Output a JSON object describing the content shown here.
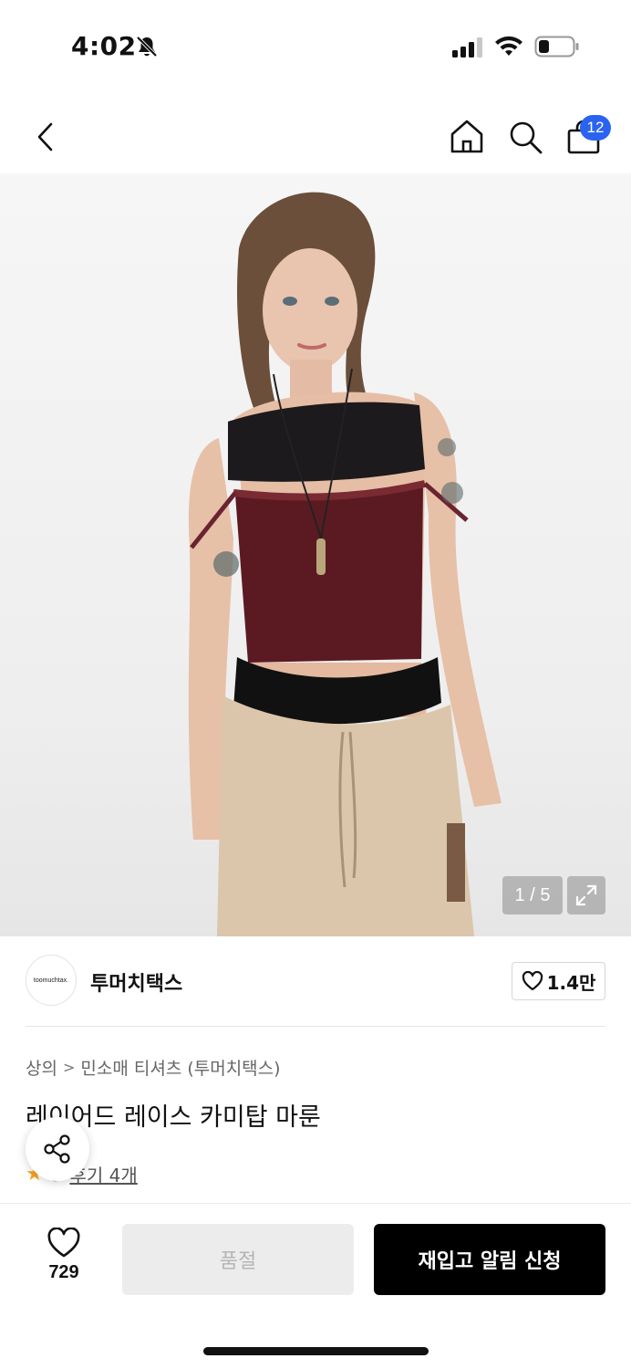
{
  "status": {
    "time": "4:02"
  },
  "header": {
    "cart_count": "12"
  },
  "gallery": {
    "counter": "1 / 5"
  },
  "brand": {
    "logo_text": "toomuchtax.",
    "name": "투머치택스",
    "likes": "1.4만"
  },
  "breadcrumb": {
    "category": "상의",
    "subcategory": "민소매 티셔츠 (투머치택스)"
  },
  "product": {
    "title": "레이어드 레이스 카미탑 마룬",
    "rating_partial": "5",
    "reviews": "후기 4개"
  },
  "bottom": {
    "wish_count": "729",
    "soldout_label": "품절",
    "restock_label": "재입고 알림 신청"
  },
  "colors": {
    "accent_badge": "#2b63f1",
    "primary_button": "#000000",
    "disabled_button": "#ececec",
    "star": "#f5a623"
  }
}
